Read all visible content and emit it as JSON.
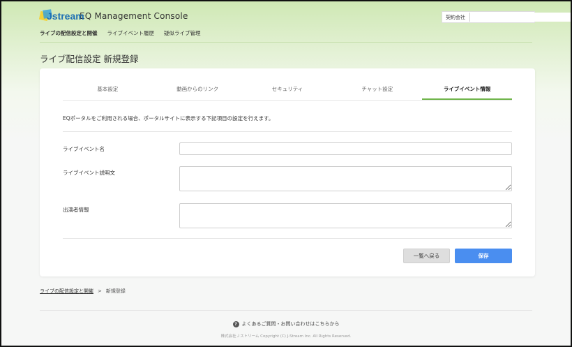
{
  "header": {
    "logo_text": "Jstream",
    "app_name": "EQ Management Console",
    "contract_label": "契約会社"
  },
  "nav": {
    "items": [
      {
        "label": "ライブの配信設定と開催",
        "active": true
      },
      {
        "label": "ライブイベント履歴",
        "active": false
      },
      {
        "label": "疑似ライブ管理",
        "active": false
      }
    ]
  },
  "page": {
    "title": "ライブ配信設定 新規登録"
  },
  "tabs": [
    {
      "label": "基本設定",
      "active": false
    },
    {
      "label": "動画からのリンク",
      "active": false
    },
    {
      "label": "セキュリティ",
      "active": false
    },
    {
      "label": "チャット設定",
      "active": false
    },
    {
      "label": "ライブイベント情報",
      "active": true
    }
  ],
  "form": {
    "description": "EQポータルをご利用される場合、ポータルサイトに表示する下記項目の設定を行えます。",
    "event_name_label": "ライブイベント名",
    "event_name_value": "",
    "event_desc_label": "ライブイベント説明文",
    "event_desc_value": "",
    "performer_label": "出演者情報",
    "performer_value": ""
  },
  "buttons": {
    "back": "一覧へ戻る",
    "save": "保存"
  },
  "breadcrumb": {
    "parent": "ライブの配信設定と開催",
    "separator": ">",
    "current": "新規登録"
  },
  "footer": {
    "faq": "よくあるご質問・お問い合わせはこちらから",
    "copyright": "株式会社Ｊストリーム Copyright (C) J-Stream Inc. All Rights Reserved."
  },
  "colors": {
    "accent_green": "#6fb44a",
    "save_blue": "#4a8ef0",
    "logo_blue": "#1d6fb3"
  }
}
